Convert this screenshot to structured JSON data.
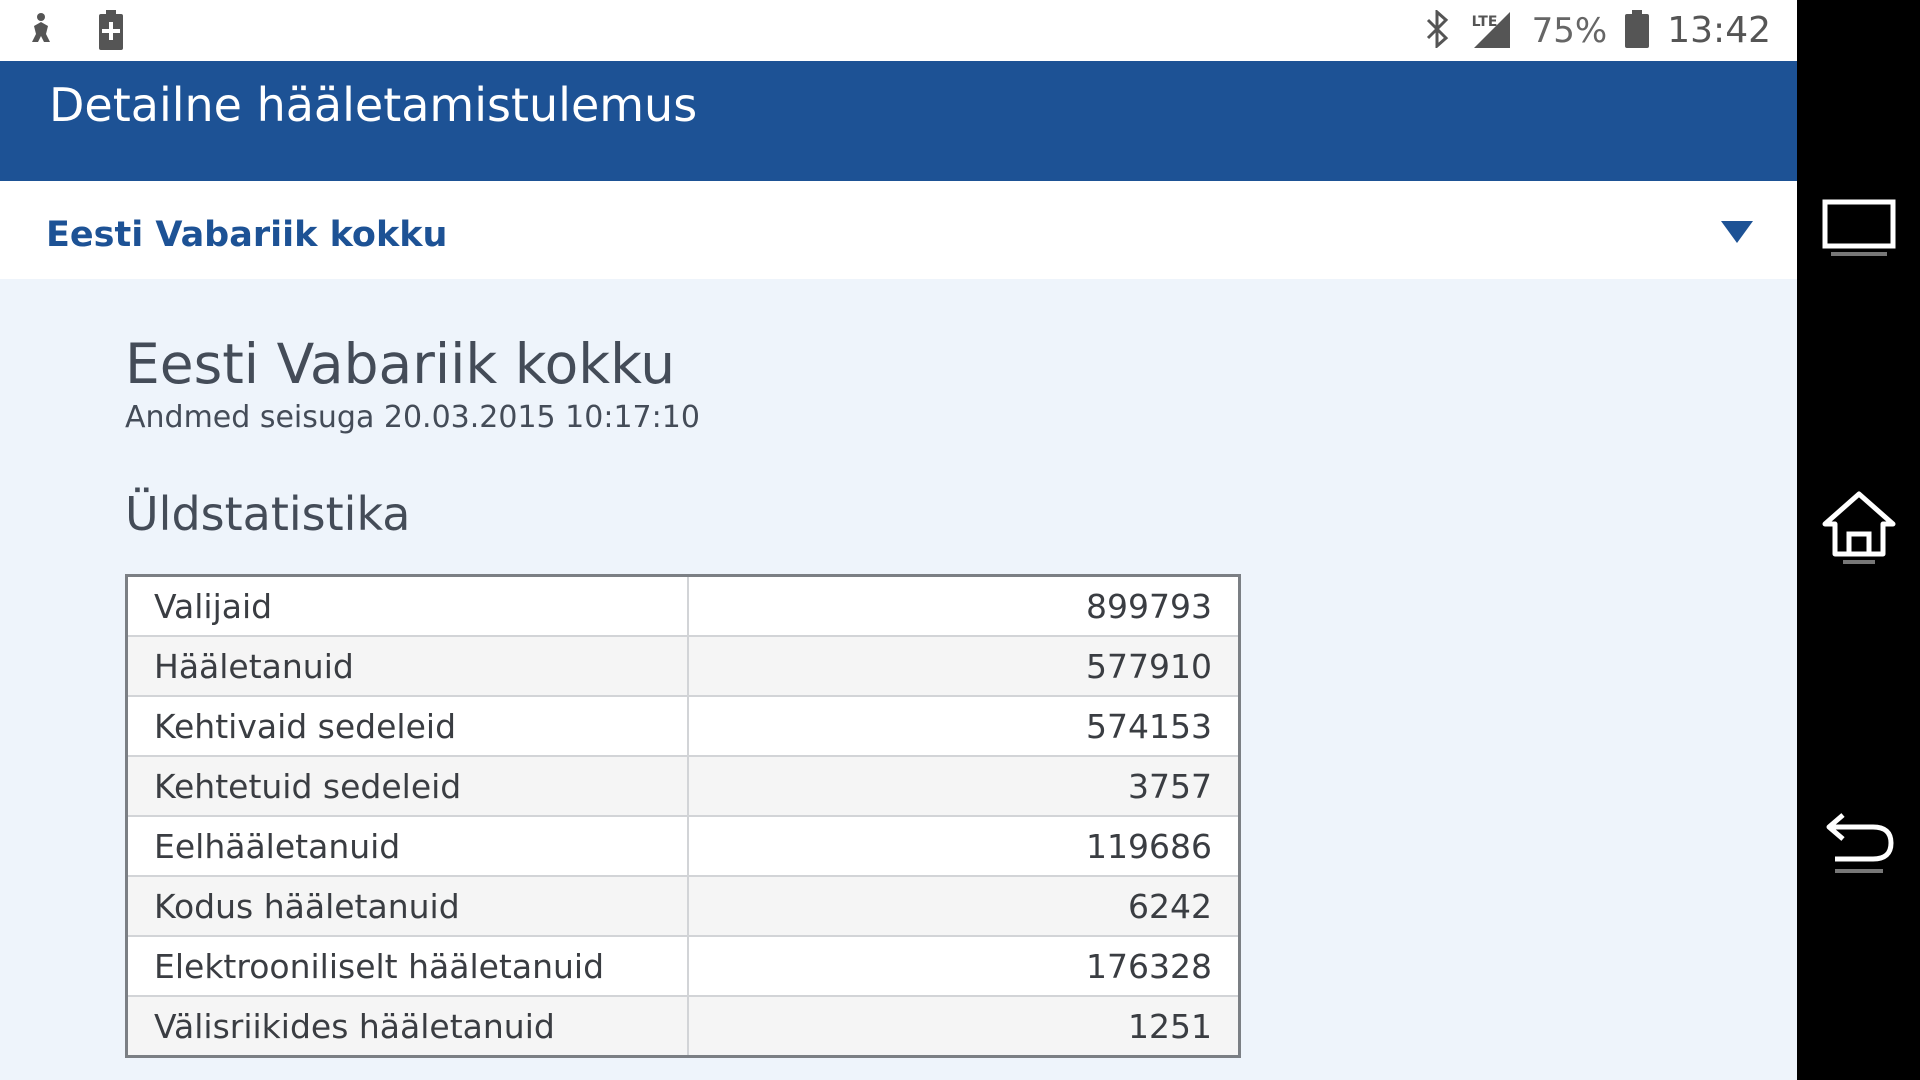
{
  "status_bar": {
    "network": "LTE",
    "battery": "75%",
    "time": "13:42"
  },
  "app_bar": {
    "title": "Detailne hääletamistulemus"
  },
  "selector": {
    "label": "Eesti Vabariik kokku"
  },
  "main": {
    "region_title": "Eesti Vabariik kokku",
    "updated": "Andmed seisuga 20.03.2015 10:17:10",
    "section_title": "Üldstatistika",
    "rows": [
      {
        "label": "Valijaid",
        "value": "899793"
      },
      {
        "label": "Hääletanuid",
        "value": "577910"
      },
      {
        "label": "Kehtivaid sedeleid",
        "value": "574153"
      },
      {
        "label": "Kehtetuid sedeleid",
        "value": "3757"
      },
      {
        "label": "Eelhääletanuid",
        "value": "119686"
      },
      {
        "label": "Kodus hääletanuid",
        "value": "6242"
      },
      {
        "label": "Elektrooniliselt hääletanuid",
        "value": "176328"
      },
      {
        "label": "Välisriikides hääletanuid",
        "value": "1251"
      }
    ]
  },
  "colors": {
    "brand": "#1d5295",
    "page_bg": "#eef4fb",
    "text": "#444c58"
  },
  "icons": {
    "status_left": [
      "usb-debug-icon",
      "battery-charging-icon"
    ],
    "status_right": [
      "bluetooth-icon",
      "signal-icon",
      "battery-icon"
    ],
    "nav": [
      "recent-apps-icon",
      "home-icon",
      "back-icon"
    ]
  }
}
